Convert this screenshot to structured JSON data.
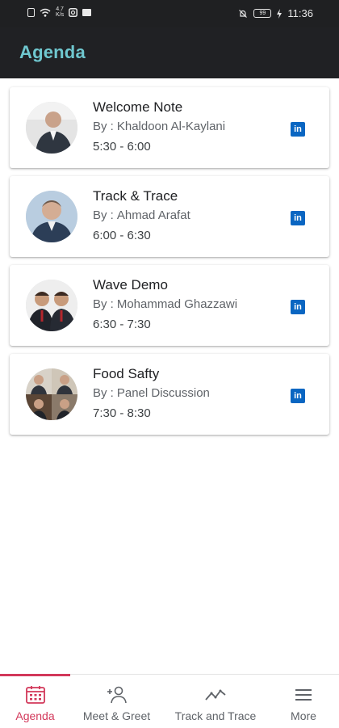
{
  "status_bar": {
    "net_speed": "4.7",
    "net_unit": "K/s",
    "battery": "99",
    "time": "11:36"
  },
  "header": {
    "title": "Agenda"
  },
  "agenda": {
    "by_label": "By :",
    "sessions": [
      {
        "title": "Welcome Note",
        "speaker": "Khaldoon Al-Kaylani",
        "time": "5:30 - 6:00",
        "link_icon": "linkedin-icon"
      },
      {
        "title": "Track & Trace",
        "speaker": "Ahmad Arafat",
        "time": "6:00 - 6:30",
        "link_icon": "linkedin-icon"
      },
      {
        "title": "Wave Demo",
        "speaker": "Mohammad Ghazzawi",
        "time": "6:30 - 7:30",
        "link_icon": "linkedin-icon"
      },
      {
        "title": "Food Safty",
        "speaker": "Panel Discussion",
        "time": "7:30 - 8:30",
        "link_icon": "linkedin-icon"
      }
    ]
  },
  "bottom_nav": {
    "active_color": "#d2385a",
    "items": [
      {
        "label": "Agenda",
        "icon": "calendar-icon",
        "active": true
      },
      {
        "label": "Meet & Greet",
        "icon": "add-person-icon",
        "active": false
      },
      {
        "label": "Track and Trace",
        "icon": "trend-line-icon",
        "active": false
      },
      {
        "label": "More",
        "icon": "menu-icon",
        "active": false
      }
    ]
  }
}
